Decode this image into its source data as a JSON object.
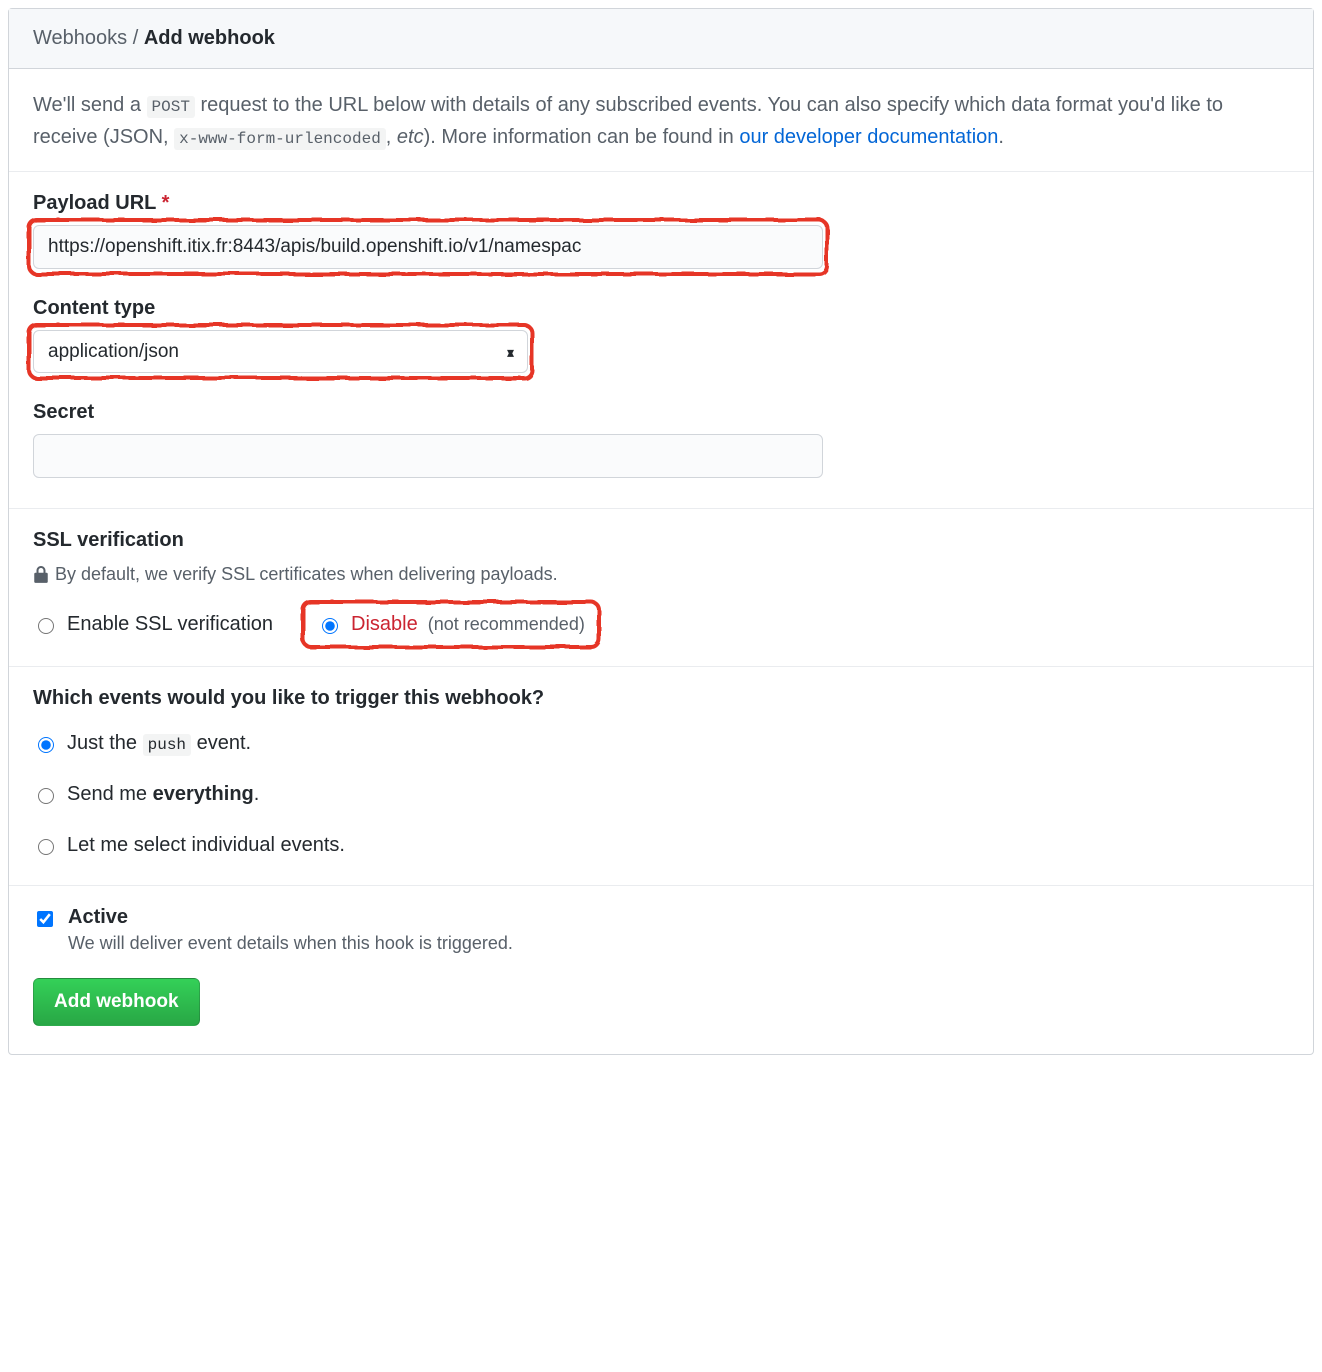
{
  "breadcrumb": {
    "root": "Webhooks",
    "sep": " / ",
    "current": "Add webhook"
  },
  "intro": {
    "pre": "We'll send a ",
    "code1": "POST",
    "mid1": " request to the URL below with details of any subscribed events. You can also specify which data format you'd like to receive (JSON, ",
    "code2": "x-www-form-urlencoded",
    "mid2": ", ",
    "etc": "etc",
    "post": "). More information can be found in ",
    "link": "our developer documentation",
    "end": "."
  },
  "payload": {
    "label": "Payload URL",
    "required": "*",
    "value": "https://openshift.itix.fr:8443/apis/build.openshift.io/v1/namespac"
  },
  "content_type": {
    "label": "Content type",
    "value": "application/json"
  },
  "secret": {
    "label": "Secret",
    "value": ""
  },
  "ssl": {
    "heading": "SSL verification",
    "note": "By default, we verify SSL certificates when delivering payloads.",
    "enable": "Enable SSL verification",
    "disable": "Disable",
    "disable_note": "(not recommended)"
  },
  "events": {
    "heading": "Which events would you like to trigger this webhook?",
    "opt1_pre": "Just the ",
    "opt1_code": "push",
    "opt1_post": " event.",
    "opt2_pre": "Send me ",
    "opt2_strong": "everything",
    "opt2_post": ".",
    "opt3": "Let me select individual events."
  },
  "active": {
    "title": "Active",
    "desc": "We will deliver event details when this hook is triggered."
  },
  "submit": "Add webhook"
}
